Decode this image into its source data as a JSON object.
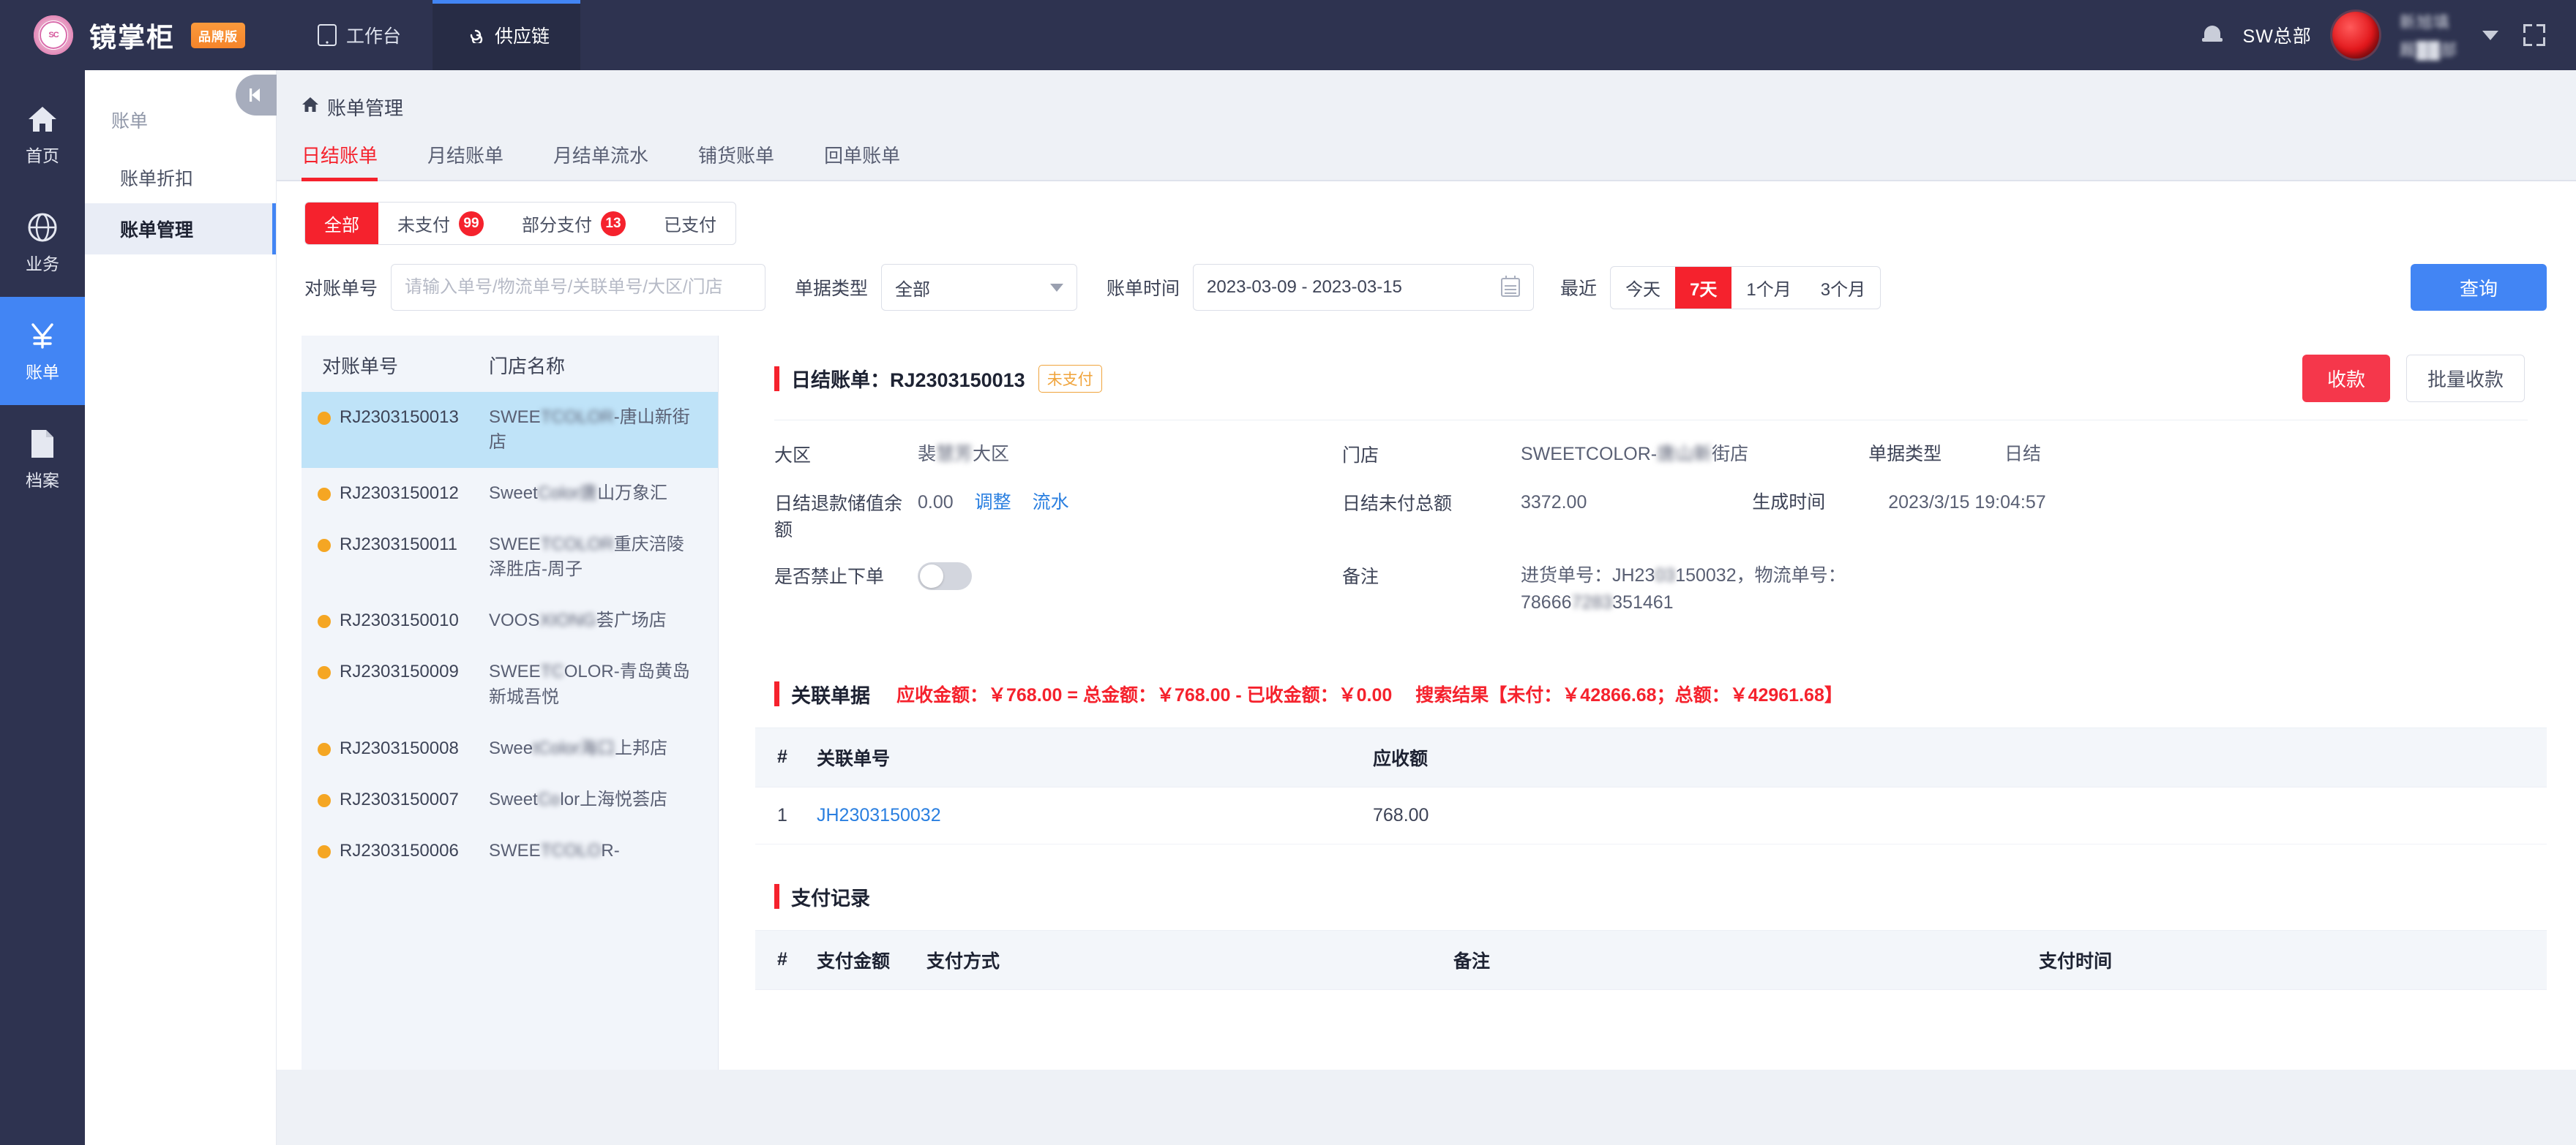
{
  "topbar": {
    "brand_name": "镜掌柜",
    "brand_badge": "品牌版",
    "nav": [
      {
        "label": "工作台",
        "icon": "tablet-icon",
        "active": false
      },
      {
        "label": "供应链",
        "icon": "link-icon",
        "active": true
      }
    ],
    "bell_icon": "bell-icon",
    "org_name": "SW总部",
    "user_name_blurred": "新旭填",
    "user_dept_blurred": "厩██部",
    "caret_icon": "chevron-down-icon",
    "fullscreen_icon": "fullscreen-icon"
  },
  "rail": [
    {
      "label": "首页",
      "icon": "home-icon",
      "active": false
    },
    {
      "label": "业务",
      "icon": "globe-icon",
      "active": false
    },
    {
      "label": "账单",
      "icon": "yuan-icon",
      "active": true
    },
    {
      "label": "档案",
      "icon": "file-icon",
      "active": false
    }
  ],
  "submenu": {
    "group_title": "账单",
    "items": [
      {
        "label": "账单折扣",
        "active": false
      },
      {
        "label": "账单管理",
        "active": true
      }
    ],
    "collapse_icon": "collapse-left-icon"
  },
  "breadcrumb": {
    "home_icon": "home-icon",
    "label": "账单管理"
  },
  "tabs": [
    {
      "label": "日结账单",
      "active": true
    },
    {
      "label": "月结账单",
      "active": false
    },
    {
      "label": "月结单流水",
      "active": false
    },
    {
      "label": "铺货账单",
      "active": false
    },
    {
      "label": "回单账单",
      "active": false
    }
  ],
  "status_chips": [
    {
      "label": "全部",
      "badge": "",
      "active": true
    },
    {
      "label": "未支付",
      "badge": "99",
      "active": false
    },
    {
      "label": "部分支付",
      "badge": "13",
      "active": false
    },
    {
      "label": "已支付",
      "badge": "",
      "active": false
    }
  ],
  "filters": {
    "bill_no_label": "对账单号",
    "bill_no_value": "",
    "bill_no_placeholder": "请输入单号/物流单号/关联单号/大区/门店",
    "doc_type_label": "单据类型",
    "doc_type_value": "全部",
    "date_label": "账单时间",
    "date_value": "2023-03-09 - 2023-03-15",
    "recent_label": "最近",
    "ranges": [
      {
        "label": "今天",
        "active": false
      },
      {
        "label": "7天",
        "active": true
      },
      {
        "label": "1个月",
        "active": false
      },
      {
        "label": "3个月",
        "active": false
      }
    ],
    "query_button": "查询"
  },
  "list": {
    "columns": [
      "对账单号",
      "门店名称"
    ],
    "rows": [
      {
        "no": "RJ2303150013",
        "store_prefix": "SWEE",
        "store_blur": "TCOLOR",
        "store_suffix": "-唐山新街店",
        "active": true
      },
      {
        "no": "RJ2303150012",
        "store_prefix": "Sweet",
        "store_blur": "Color唐",
        "store_suffix": "山万象汇",
        "active": false
      },
      {
        "no": "RJ2303150011",
        "store_prefix": "SWEE",
        "store_blur": "TCOLOR",
        "store_suffix": "重庆涪陵泽胜店-周子",
        "active": false
      },
      {
        "no": "RJ2303150010",
        "store_prefix": "VOOS",
        "store_blur": "XIONG",
        "store_suffix": "荟广场店",
        "active": false
      },
      {
        "no": "RJ2303150009",
        "store_prefix": "SWEE",
        "store_blur": "TC",
        "store_suffix": "OLOR-青岛黄岛新城吾悦",
        "active": false
      },
      {
        "no": "RJ2303150008",
        "store_prefix": "Swee",
        "store_blur": "tColor海口",
        "store_suffix": "上邦店",
        "active": false
      },
      {
        "no": "RJ2303150007",
        "store_prefix": "Sweet",
        "store_blur": "Co",
        "store_suffix": "lor上海悦荟店",
        "active": false
      },
      {
        "no": "RJ2303150006",
        "store_prefix": "SWEE",
        "store_blur": "TCOLO",
        "store_suffix": "R-",
        "active": false
      }
    ]
  },
  "detail": {
    "title_prefix": "日结账单：",
    "bill_no": "RJ2303150013",
    "status": "未支付",
    "collect_button": "收款",
    "batch_collect_button": "批量收款",
    "fields": {
      "region_label": "大区",
      "region_prefix": "裴",
      "region_blur": "慧芳",
      "region_suffix": "大区",
      "store_label": "门店",
      "store_prefix": "SWEETCOLOR-",
      "store_blur": "唐山新",
      "store_suffix": "街店",
      "doc_type_label": "单据类型",
      "doc_type_value": "日结",
      "refund_balance_label": "日结退款储值余额",
      "refund_balance_value": "0.00",
      "adjust_link": "调整",
      "flow_link": "流水",
      "unpaid_total_label": "日结未付总额",
      "unpaid_total_value": "3372.00",
      "created_label": "生成时间",
      "created_value": "2023/3/15 19:04:57",
      "forbid_order_label": "是否禁止下单",
      "forbid_order_on": false,
      "remark_label": "备注",
      "remark_line1_prefix": "进货单号：JH23",
      "remark_line1_blur": "03",
      "remark_line1_suffix": "150032，物流单号：",
      "remark_line2_prefix": "78666",
      "remark_line2_blur": "7283",
      "remark_line2_suffix": "351461"
    }
  },
  "related": {
    "section_title": "关联单据",
    "summary": "应收金额：￥768.00 = 总金额：￥768.00 - 已收金额：￥0.00",
    "search_result": "搜索结果【未付：￥42866.68；总额：￥42961.68】",
    "columns": [
      "#",
      "关联单号",
      "应收额"
    ],
    "rows": [
      {
        "idx": "1",
        "no": "JH2303150032",
        "amount": "768.00"
      }
    ]
  },
  "payments": {
    "section_title": "支付记录",
    "columns": [
      "#",
      "支付金额",
      "支付方式",
      "备注",
      "支付时间"
    ],
    "rows": []
  },
  "colors": {
    "nav_bg": "#2e3350",
    "accent_blue": "#4285f4",
    "accent_red": "#f5222d",
    "status_orange": "#f0a43c",
    "dot_orange": "#f5a623",
    "selected_row": "#bfe3f8",
    "link_blue": "#2a7fe0"
  }
}
